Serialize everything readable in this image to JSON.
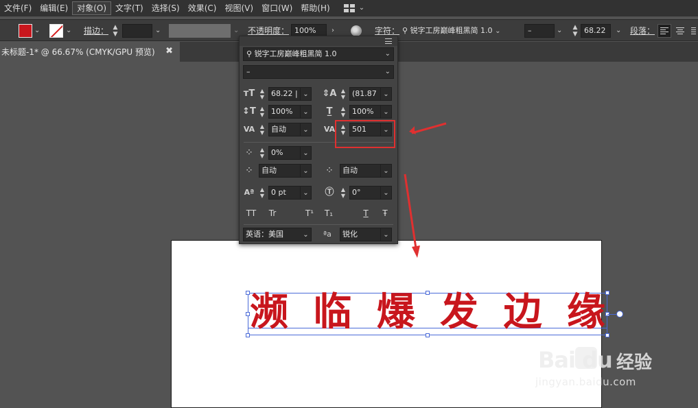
{
  "menubar": {
    "items": [
      "文件(F)",
      "编辑(E)",
      "对象(O)",
      "文字(T)",
      "选择(S)",
      "效果(C)",
      "视图(V)",
      "窗口(W)",
      "帮助(H)"
    ],
    "active_index": 2
  },
  "controlbar": {
    "stroke_label": "描边：",
    "opacity_label": "不透明度：",
    "opacity_value": "100%",
    "character_label": "字符：",
    "font_name": "锐字工房巅峰粗黑简 1.0",
    "font_style": "–",
    "font_size": "68.22",
    "paragraph_label": "段落："
  },
  "document_tab": {
    "title": "未标题-1* @ 66.67% (CMYK/GPU 预览)",
    "close_glyph": "✖"
  },
  "character_panel": {
    "font_family": "锐字工房巅峰粗黑简 1.0",
    "font_style": "–",
    "font_size": "68.22 |",
    "leading": "(81.87",
    "vertical_scale": "100%",
    "horizontal_scale": "100%",
    "kerning": "自动",
    "tracking": "501",
    "tsume": "0%",
    "aki_left": "自动",
    "aki_right": "自动",
    "baseline_shift": "0 pt",
    "rotation": "0°",
    "text_buttons": [
      "TT",
      "Tr",
      "T¹",
      "T₁",
      "T",
      "Ŧ"
    ],
    "language": "英语：美国",
    "antialias_label": "ªa",
    "antialias": "锐化"
  },
  "artboard_text": {
    "characters": [
      "濒",
      "临",
      "爆",
      "发",
      "边",
      "缘"
    ],
    "color": "#c8161d"
  },
  "watermark": {
    "logo": "Bai  du",
    "title": "经验",
    "url": "jingyan.baidu.com"
  },
  "colors": {
    "fill": "#c8161d",
    "accent_annotation": "#e03030",
    "selection": "#4a6ad8"
  }
}
